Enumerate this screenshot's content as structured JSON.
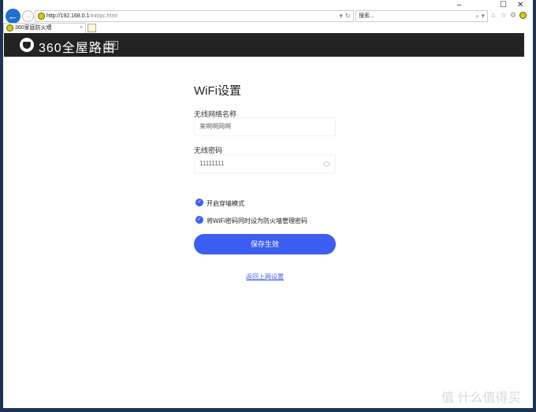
{
  "browser": {
    "url_host": "http://192.168.0.1",
    "url_path": "/init/pc.html",
    "search_placeholder": "搜索...",
    "tab_title": "360家庭防火墙",
    "tab_close": "×"
  },
  "header": {
    "brand": "360全屋路由",
    "model": "M5"
  },
  "form": {
    "title": "WiFi设置",
    "ssid_label": "无线网络名称",
    "ssid_value": "来啊啊网啊",
    "pwd_label": "无线密码",
    "pwd_value": "11111111",
    "options": [
      {
        "label": "开启穿墙模式",
        "checked": true
      },
      {
        "label": "将WiFi密码同时设为防火墙管理密码",
        "checked": true
      }
    ],
    "save_label": "保存生效",
    "back_link": "返回上网设置"
  },
  "watermark": "值 什么值得买",
  "colors": {
    "accent": "#3d5ef2",
    "header": "#232323"
  }
}
